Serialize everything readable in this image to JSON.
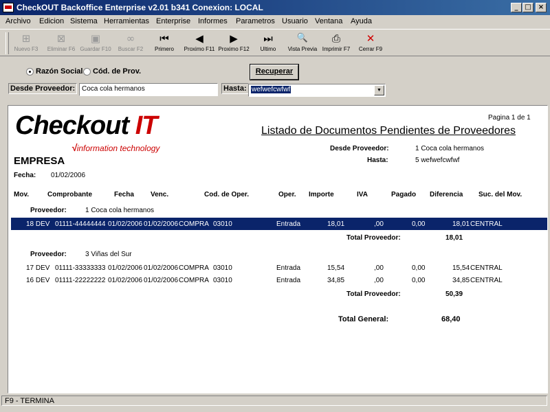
{
  "window": {
    "title": "CheckOUT Backoffice Enterprise v2.01 b341 Conexion: LOCAL",
    "min": "_",
    "max": "□",
    "close": "×"
  },
  "menu": [
    "Archivo",
    "Edicion",
    "Sistema",
    "Herramientas",
    "Enterprise",
    "Informes",
    "Parametros",
    "Usuario",
    "Ventana",
    "Ayuda"
  ],
  "toolbar": [
    {
      "label": "Nuevo F3",
      "icon": "new-icon",
      "glyph": "⊞"
    },
    {
      "label": "Eliminar F6",
      "icon": "delete-icon",
      "glyph": "⊠"
    },
    {
      "label": "Guardar F10",
      "icon": "save-icon",
      "glyph": "▣"
    },
    {
      "label": "Buscar F2",
      "icon": "binoculars-icon",
      "glyph": "∞"
    },
    {
      "label": "Primero",
      "icon": "first-icon",
      "glyph": "⏮"
    },
    {
      "label": "Proximo F11",
      "icon": "prev-icon",
      "glyph": "◀"
    },
    {
      "label": "Proximo F12",
      "icon": "next-icon",
      "glyph": "▶"
    },
    {
      "label": "Ultimo",
      "icon": "last-icon",
      "glyph": "⏭"
    },
    {
      "label": "Vista Previa",
      "icon": "preview-icon",
      "glyph": "🔍"
    },
    {
      "label": "Imprimir F7",
      "icon": "printer-icon",
      "glyph": "⎙"
    },
    {
      "label": "Cerrar F9",
      "icon": "close-x-icon",
      "glyph": "✕"
    }
  ],
  "filter": {
    "radio_razon": "Razón Social",
    "radio_cod": "Cód. de Prov.",
    "recuperar": "Recuperar",
    "desde_label": "Desde Proveedor:",
    "desde_value": "Coca cola hermanos",
    "hasta_label": "Hasta:",
    "hasta_value": "wefwefcwfwf"
  },
  "report": {
    "page": "Pagina 1 de 1",
    "logo_main": "Checkout",
    "logo_it": "IT",
    "logo_sub": "information technology",
    "title": "Listado de Documentos Pendientes de Proveedores",
    "desde_label": "Desde Proveedor:",
    "desde_value": "1 Coca cola hermanos",
    "hasta_label": "Hasta:",
    "hasta_value": "5 wefwefcwfwf",
    "empresa": "EMPRESA",
    "fecha_label": "Fecha:",
    "fecha_value": "01/02/2006",
    "columns": [
      "Mov.",
      "Comprobante",
      "Fecha",
      "Venc.",
      "Cod. de Oper.",
      "Oper.",
      "Importe",
      "IVA",
      "Pagado",
      "Diferencia",
      "Suc. del Mov."
    ],
    "groups": [
      {
        "label": "Proveedor:",
        "name": "1 Coca cola hermanos",
        "rows": [
          {
            "mov": "18 DEV",
            "comp": "01111-44444444",
            "fecha": "01/02/2006",
            "venc": "01/02/2006",
            "oper_name": "COMPRA",
            "oper_code": "03010",
            "oper": "Entrada",
            "importe": "18,01",
            "iva": ",00",
            "pagado": "0,00",
            "dif": "18,01",
            "suc": "CENTRAL"
          }
        ],
        "total_label": "Total Proveedor:",
        "total": "18,01"
      },
      {
        "label": "Proveedor:",
        "name": "3 Viñas del Sur",
        "rows": [
          {
            "mov": "17 DEV",
            "comp": "01111-33333333",
            "fecha": "01/02/2006",
            "venc": "01/02/2006",
            "oper_name": "COMPRA",
            "oper_code": "03010",
            "oper": "Entrada",
            "importe": "15,54",
            "iva": ",00",
            "pagado": "0,00",
            "dif": "15,54",
            "suc": "CENTRAL"
          },
          {
            "mov": "16 DEV",
            "comp": "01111-22222222",
            "fecha": "01/02/2006",
            "venc": "01/02/2006",
            "oper_name": "COMPRA",
            "oper_code": "03010",
            "oper": "Entrada",
            "importe": "34,85",
            "iva": ",00",
            "pagado": "0,00",
            "dif": "34,85",
            "suc": "CENTRAL"
          }
        ],
        "total_label": "Total Proveedor:",
        "total": "50,39"
      }
    ],
    "grand_label": "Total General:",
    "grand_total": "68,40"
  },
  "status": "F9 - TERMINA",
  "colors": {
    "selection": "#0a246a",
    "logo_red": "#cc0000"
  }
}
